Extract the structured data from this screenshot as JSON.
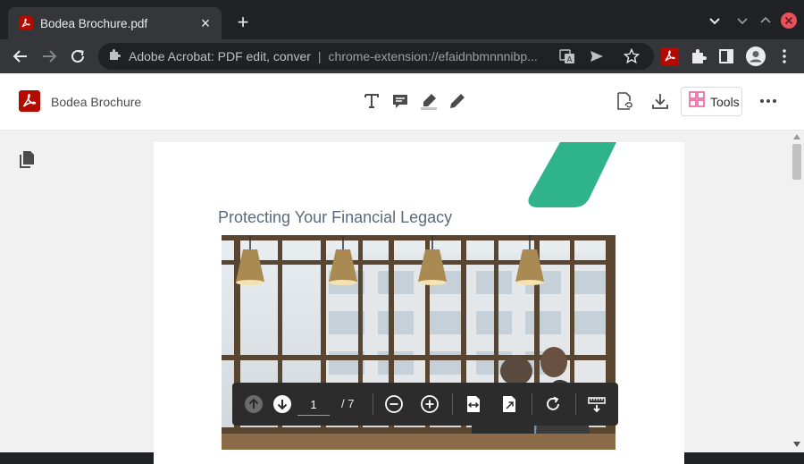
{
  "tab": {
    "title": "Bodea Brochure.pdf",
    "close": "×",
    "new_tab": "+"
  },
  "omnibox": {
    "extension_name": "Adobe Acrobat: PDF edit, conver",
    "separator": "|",
    "url": "chrome-extension://efaidnbmnnnibp..."
  },
  "app": {
    "doc_title": "Bodea Brochure",
    "tools_label": "Tools"
  },
  "page": {
    "heading": "Protecting Your Financial Legacy"
  },
  "page_nav": {
    "current_page": "1",
    "total": "/ 7"
  },
  "colors": {
    "acrobat_red": "#b30b00",
    "accent_green": "#2fb38a",
    "tools_pink": "#e8609d"
  }
}
